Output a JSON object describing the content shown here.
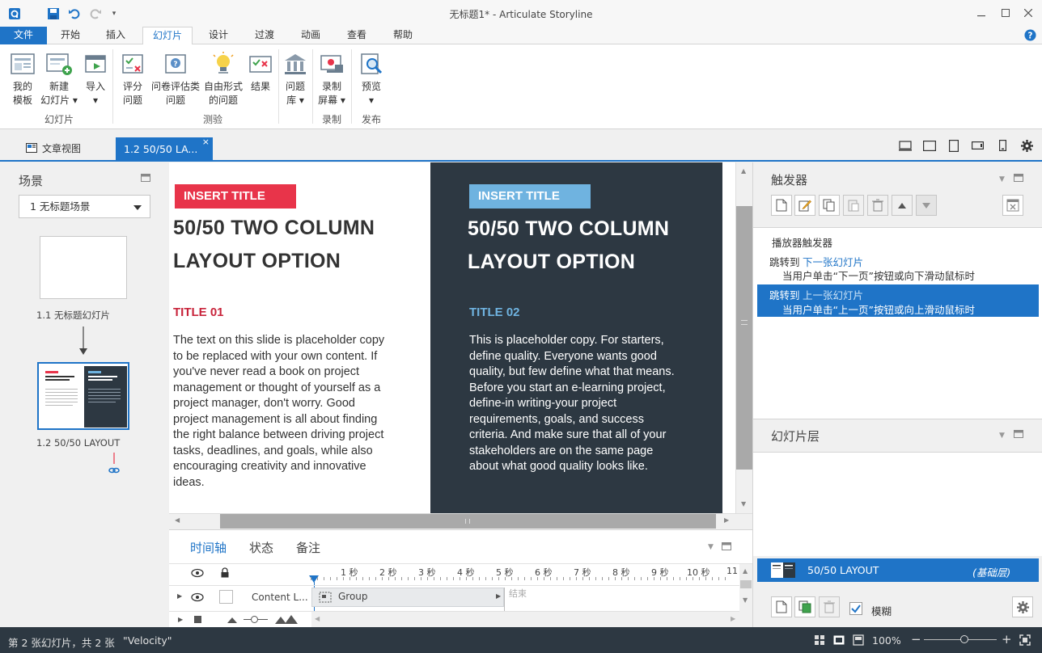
{
  "window": {
    "title": "无标题1* - Articulate Storyline",
    "controls": [
      "minimize-icon",
      "restore-icon",
      "close-icon"
    ]
  },
  "menu": {
    "file": "文件",
    "tabs": [
      "开始",
      "插入",
      "幻灯片",
      "设计",
      "过渡",
      "动画",
      "查看",
      "帮助"
    ],
    "active": "幻灯片"
  },
  "ribbon": {
    "buttons": [
      {
        "line1": "我的",
        "line2": "模板"
      },
      {
        "line1": "新建",
        "line2": "幻灯片 ▾"
      },
      {
        "line1": "导入",
        "line2": "▾"
      },
      {
        "line1": "评分",
        "line2": "问题"
      },
      {
        "line1": "问卷评估类",
        "line2": "问题"
      },
      {
        "line1": "自由形式",
        "line2": "的问题"
      },
      {
        "line1": "结果",
        "line2": ""
      },
      {
        "line1": "问题",
        "line2": "库 ▾"
      },
      {
        "line1": "录制",
        "line2": "屏幕 ▾"
      },
      {
        "line1": "预览",
        "line2": "▾"
      }
    ],
    "groups": [
      "幻灯片",
      "测验",
      "录制",
      "发布"
    ]
  },
  "doc_tabs": {
    "story_view": "文章视图",
    "slide_tab": "1.2 50/50 LA...",
    "close": "×"
  },
  "scenes": {
    "title": "场景",
    "selected": "1 无标题场景",
    "slides": [
      {
        "label": "1.1 无标题幻灯片"
      },
      {
        "label": "1.2 50/50 LAYOUT"
      }
    ]
  },
  "slide": {
    "left": {
      "tag": "INSERT TITLE",
      "title_line1": "50/50 TWO COLUMN",
      "title_line2": "LAYOUT OPTION",
      "subtitle": "TITLE 01",
      "body": "The text on this slide is placeholder copy to be replaced with your own content. If you've never read a book on project management or thought of yourself as a project manager, don't worry. Good project management is all about finding the right balance between driving project tasks, deadlines, and goals, while also encouraging creativity and innovative ideas."
    },
    "right": {
      "tag": "INSERT TITLE",
      "title_line1": "50/50 TWO COLUMN",
      "title_line2": "LAYOUT OPTION",
      "subtitle": "TITLE 02",
      "body": "This is placeholder copy. For starters, define quality. Everyone wants good quality, but few define what that means. Before you start an e-learning project, define-in writing-your project requirements, goals, and success criteria. And make sure that all of your stakeholders are on the same page about what good quality looks like."
    },
    "colors": {
      "red": "#e8344a",
      "blue": "#6fb3e0",
      "dark": "#2d3842",
      "accent": "#1f74c7"
    }
  },
  "timeline": {
    "tabs": [
      "时间轴",
      "状态",
      "备注"
    ],
    "ticks": [
      "1 秒",
      "2 秒",
      "3 秒",
      "4 秒",
      "5 秒",
      "6 秒",
      "7 秒",
      "8 秒",
      "9 秒",
      "10 秒",
      "11"
    ],
    "row": {
      "name": "Content L...",
      "block": "Group",
      "end": "结束"
    }
  },
  "triggers": {
    "title": "触发器",
    "section": "播放器触发器",
    "items": [
      {
        "action": "跳转到",
        "target": "下一张幻灯片",
        "condition": "当用户单击“下一页”按钮或向下滑动鼠标时",
        "selected": false
      },
      {
        "action": "跳转到",
        "target": "上一张幻灯片",
        "condition": "当用户单击“上一页”按钮或向上滑动鼠标时",
        "selected": true
      }
    ]
  },
  "layers": {
    "title": "幻灯片层",
    "base_name": "50/50 LAYOUT",
    "base_tag": "(基础层)",
    "dim_label": "模糊",
    "dim_checked": true
  },
  "status": {
    "position": "第 2 张幻灯片，共 2 张",
    "theme": "\"Velocity\"",
    "zoom": "100%",
    "zoom_fraction": 0.55
  }
}
